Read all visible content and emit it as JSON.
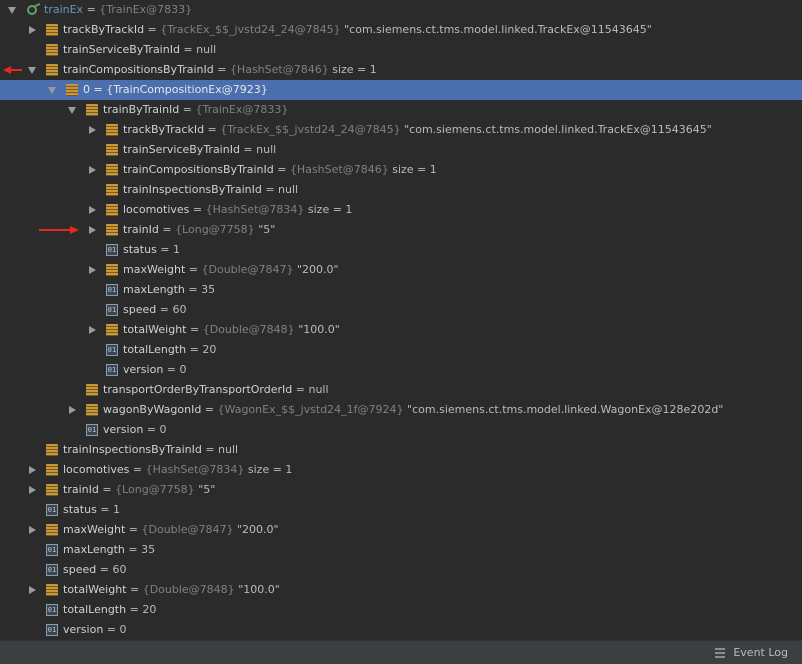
{
  "tree": {
    "rows": [
      {
        "kind": "watch",
        "name": "trainEx",
        "ref": "{TrainEx@7833}",
        "value": "",
        "expander": "down",
        "depth": 0
      },
      {
        "kind": "field",
        "name": "trackByTrackId",
        "ref": "{TrackEx_$$_jvstd24_24@7845}",
        "value": "\"com.siemens.ct.tms.model.linked.TrackEx@11543645\"",
        "expander": "right",
        "depth": 1
      },
      {
        "kind": "field",
        "name": "trainServiceByTrainId",
        "ref": "",
        "value": "null",
        "expander": "none",
        "depth": 1
      },
      {
        "kind": "field",
        "name": "trainCompositionsByTrainId",
        "ref": "{HashSet@7846}",
        "value": "size = 1",
        "expander": "down",
        "depth": 1
      },
      {
        "kind": "field",
        "name": "0",
        "ref": "{TrainCompositionEx@7923}",
        "value": "",
        "expander": "down",
        "depth": 2,
        "selected": true
      },
      {
        "kind": "field",
        "name": "trainByTrainId",
        "ref": "{TrainEx@7833}",
        "value": "",
        "expander": "down",
        "depth": 3
      },
      {
        "kind": "field",
        "name": "trackByTrackId",
        "ref": "{TrackEx_$$_jvstd24_24@7845}",
        "value": "\"com.siemens.ct.tms.model.linked.TrackEx@11543645\"",
        "expander": "right",
        "depth": 4
      },
      {
        "kind": "field",
        "name": "trainServiceByTrainId",
        "ref": "",
        "value": "null",
        "expander": "none",
        "depth": 4
      },
      {
        "kind": "field",
        "name": "trainCompositionsByTrainId",
        "ref": "{HashSet@7846}",
        "value": "size = 1",
        "expander": "right",
        "depth": 4
      },
      {
        "kind": "field",
        "name": "trainInspectionsByTrainId",
        "ref": "",
        "value": "null",
        "expander": "none",
        "depth": 4
      },
      {
        "kind": "field",
        "name": "locomotives",
        "ref": "{HashSet@7834}",
        "value": "size = 1",
        "expander": "right",
        "depth": 4
      },
      {
        "kind": "field",
        "name": "trainId",
        "ref": "{Long@7758}",
        "value": "\"5\"",
        "expander": "right",
        "depth": 4
      },
      {
        "kind": "prim",
        "name": "status",
        "ref": "",
        "value": "1",
        "expander": "none",
        "depth": 4
      },
      {
        "kind": "field",
        "name": "maxWeight",
        "ref": "{Double@7847}",
        "value": "\"200.0\"",
        "expander": "right",
        "depth": 4
      },
      {
        "kind": "prim",
        "name": "maxLength",
        "ref": "",
        "value": "35",
        "expander": "none",
        "depth": 4
      },
      {
        "kind": "prim",
        "name": "speed",
        "ref": "",
        "value": "60",
        "expander": "none",
        "depth": 4
      },
      {
        "kind": "field",
        "name": "totalWeight",
        "ref": "{Double@7848}",
        "value": "\"100.0\"",
        "expander": "right",
        "depth": 4
      },
      {
        "kind": "prim",
        "name": "totalLength",
        "ref": "",
        "value": "20",
        "expander": "none",
        "depth": 4
      },
      {
        "kind": "prim",
        "name": "version",
        "ref": "",
        "value": "0",
        "expander": "none",
        "depth": 4
      },
      {
        "kind": "field",
        "name": "transportOrderByTransportOrderId",
        "ref": "",
        "value": "null",
        "expander": "none",
        "depth": 3
      },
      {
        "kind": "field",
        "name": "wagonByWagonId",
        "ref": "{WagonEx_$$_jvstd24_1f@7924}",
        "value": "\"com.siemens.ct.tms.model.linked.WagonEx@128e202d\"",
        "expander": "right",
        "depth": 3
      },
      {
        "kind": "prim",
        "name": "version",
        "ref": "",
        "value": "0",
        "expander": "none",
        "depth": 3
      },
      {
        "kind": "field",
        "name": "trainInspectionsByTrainId",
        "ref": "",
        "value": "null",
        "expander": "none",
        "depth": 1
      },
      {
        "kind": "field",
        "name": "locomotives",
        "ref": "{HashSet@7834}",
        "value": "size = 1",
        "expander": "right",
        "depth": 1
      },
      {
        "kind": "field",
        "name": "trainId",
        "ref": "{Long@7758}",
        "value": "\"5\"",
        "expander": "right",
        "depth": 1
      },
      {
        "kind": "prim",
        "name": "status",
        "ref": "",
        "value": "1",
        "expander": "none",
        "depth": 1
      },
      {
        "kind": "field",
        "name": "maxWeight",
        "ref": "{Double@7847}",
        "value": "\"200.0\"",
        "expander": "right",
        "depth": 1
      },
      {
        "kind": "prim",
        "name": "maxLength",
        "ref": "",
        "value": "35",
        "expander": "none",
        "depth": 1
      },
      {
        "kind": "prim",
        "name": "speed",
        "ref": "",
        "value": "60",
        "expander": "none",
        "depth": 1
      },
      {
        "kind": "field",
        "name": "totalWeight",
        "ref": "{Double@7848}",
        "value": "\"100.0\"",
        "expander": "right",
        "depth": 1
      },
      {
        "kind": "prim",
        "name": "totalLength",
        "ref": "",
        "value": "20",
        "expander": "none",
        "depth": 1
      },
      {
        "kind": "prim",
        "name": "version",
        "ref": "",
        "value": "0",
        "expander": "none",
        "depth": 1
      }
    ],
    "annotations": [
      {
        "row": 3,
        "style": "short"
      },
      {
        "row": 11,
        "style": "long"
      }
    ]
  },
  "status_bar": {
    "event_log_label": "Event Log"
  },
  "colors": {
    "background": "#2b2b2b",
    "selection": "#4b6eaf",
    "reference": "#808080",
    "watch_name": "#6897bb",
    "annotation_arrow": "#e8281e"
  }
}
